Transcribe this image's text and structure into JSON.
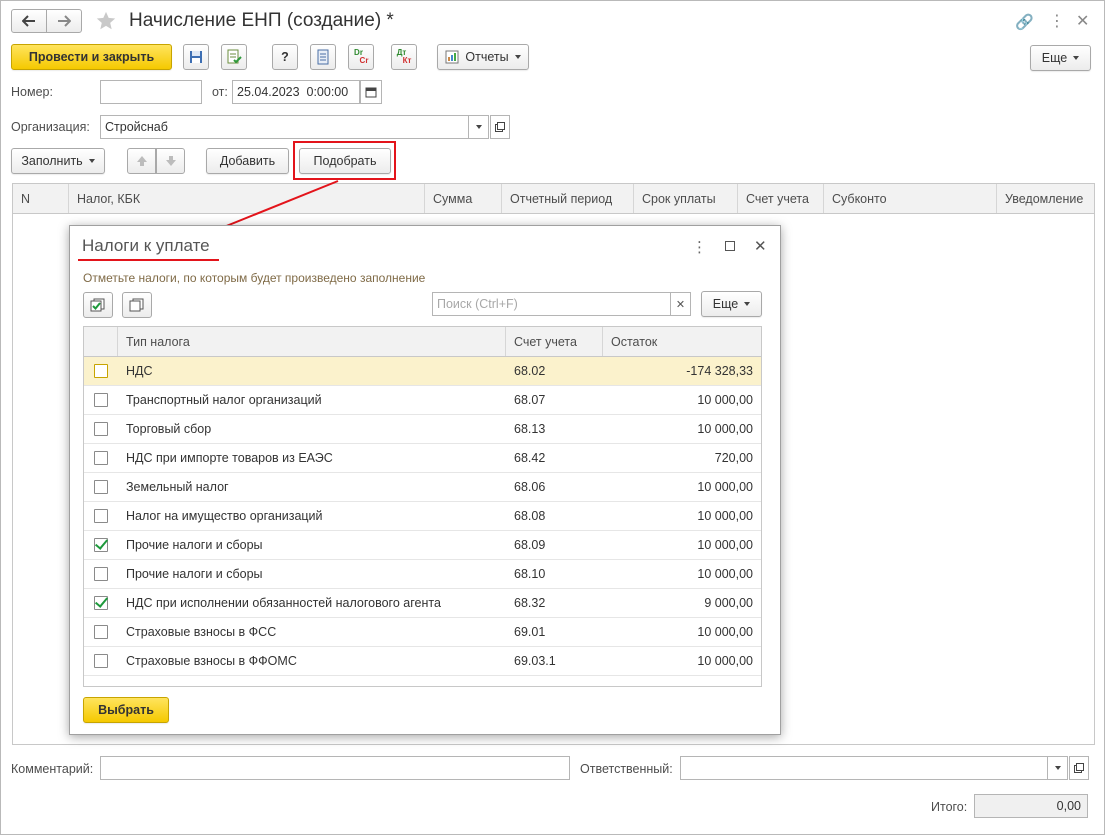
{
  "window": {
    "title": "Начисление ЕНП (создание) *",
    "back_icon": "arrow-left-icon",
    "forward_icon": "arrow-right-icon",
    "favorite_icon": "star-icon"
  },
  "toolbar": {
    "post_close": "Провести и закрыть",
    "help": "?",
    "reports": "Отчеты",
    "more": "Еще",
    "dt_kt_top": "Dr",
    "dt_kt_bottom": "Cr",
    "dt_top": "Дт",
    "kt_bottom": "Кт"
  },
  "form": {
    "number_label": "Номер:",
    "number_value": "",
    "date_label": "от:",
    "date_value": "25.04.2023  0:00:00",
    "org_label": "Организация:",
    "org_value": "Стройснаб"
  },
  "table_toolbar": {
    "fill": "Заполнить",
    "add": "Добавить",
    "pick": "Подобрать"
  },
  "main_table": {
    "columns": [
      "N",
      "Налог, КБК",
      "Сумма",
      "Отчетный период",
      "Срок уплаты",
      "Счет учета",
      "Субконто",
      "Уведомление"
    ]
  },
  "dialog": {
    "title": "Налоги к уплате",
    "hint": "Отметьте налоги, по которым будет произведено заполнение",
    "search_placeholder": "Поиск (Ctrl+F)",
    "more": "Еще",
    "select": "Выбрать",
    "columns": [
      "Тип налога",
      "Счет учета",
      "Остаток"
    ],
    "rows": [
      {
        "checked": false,
        "name": "НДС",
        "account": "68.02",
        "balance": "-174 328,33"
      },
      {
        "checked": false,
        "name": "Транспортный налог организаций",
        "account": "68.07",
        "balance": "10 000,00"
      },
      {
        "checked": false,
        "name": "Торговый сбор",
        "account": "68.13",
        "balance": "10 000,00"
      },
      {
        "checked": false,
        "name": "НДС при импорте товаров из ЕАЭС",
        "account": "68.42",
        "balance": "720,00"
      },
      {
        "checked": false,
        "name": "Земельный налог",
        "account": "68.06",
        "balance": "10 000,00"
      },
      {
        "checked": false,
        "name": "Налог на имущество организаций",
        "account": "68.08",
        "balance": "10 000,00"
      },
      {
        "checked": true,
        "name": "Прочие налоги и сборы",
        "account": "68.09",
        "balance": "10 000,00"
      },
      {
        "checked": false,
        "name": "Прочие налоги и сборы",
        "account": "68.10",
        "balance": "10 000,00"
      },
      {
        "checked": true,
        "name": "НДС при исполнении обязанностей налогового агента",
        "account": "68.32",
        "balance": "9 000,00"
      },
      {
        "checked": false,
        "name": "Страховые взносы в ФСС",
        "account": "69.01",
        "balance": "10 000,00"
      },
      {
        "checked": false,
        "name": "Страховые взносы в ФФОМС",
        "account": "69.03.1",
        "balance": "10 000,00"
      }
    ]
  },
  "footer": {
    "comment_label": "Комментарий:",
    "comment_value": "",
    "responsible_label": "Ответственный:",
    "responsible_value": "",
    "total_label": "Итого:",
    "total_value": "0,00"
  },
  "colors": {
    "accent_yellow": "#f5c900",
    "highlight_red": "#e3141b",
    "selected_row": "#fbf2cc",
    "check_green": "#1e9a3c"
  }
}
